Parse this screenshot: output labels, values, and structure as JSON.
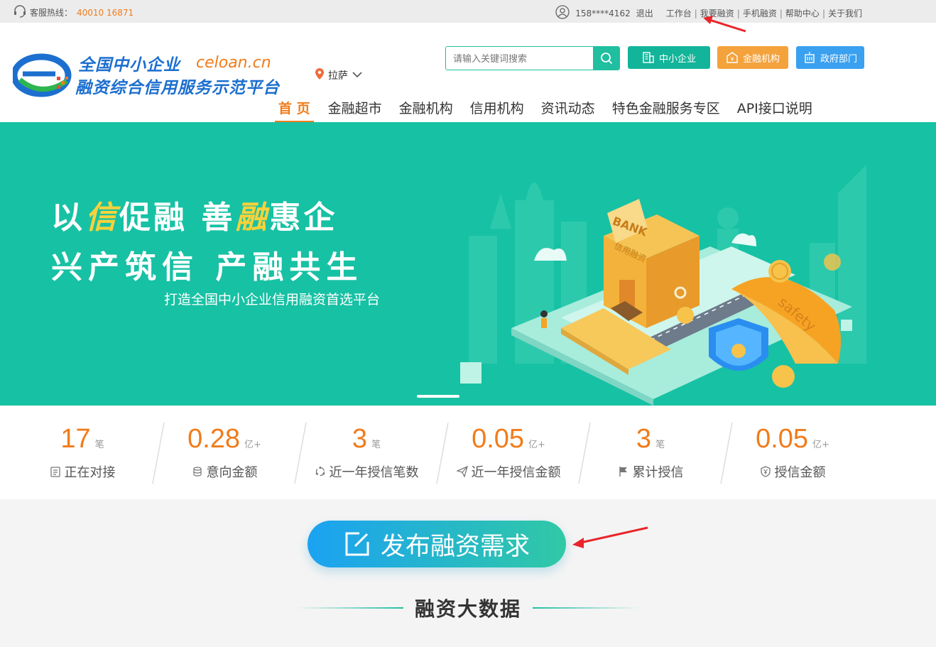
{
  "topbar": {
    "hotline_label": "客服热线：",
    "hotline_number": "40010 16871",
    "user_phone": "158****4162",
    "logout": "退出",
    "links": [
      "工作台",
      "我要融资",
      "手机融资",
      "帮助中心",
      "关于我们"
    ]
  },
  "header": {
    "logo_title1": "全国中小企业",
    "logo_url": "celoan.cn",
    "logo_title2": "融资综合信用服务示范平台",
    "location": "拉萨",
    "search_placeholder": "请输入关键词搜索",
    "quick_buttons": [
      {
        "label": "中小企业",
        "color": "#13b59a"
      },
      {
        "label": "金融机构",
        "color": "#f4a23c"
      },
      {
        "label": "政府部门",
        "color": "#3aa0f0"
      }
    ]
  },
  "nav": {
    "items": [
      "首 页",
      "金融超市",
      "金融机构",
      "信用机构",
      "资讯动态",
      "特色金融服务专区",
      "API接口说明"
    ],
    "active": "首 页"
  },
  "banner": {
    "slogan_line1_a": "以",
    "slogan_line1_b": "信",
    "slogan_line1_c": "促融  善",
    "slogan_line1_d": "融",
    "slogan_line1_e": "惠企",
    "slogan_line2": "兴产筑信  产融共生",
    "slogan_sub": "打造全国中小企业信用融资首选平台",
    "illustration_texts": {
      "bank": "BANK",
      "bank_sign": "信用融资",
      "umbrella": "safety"
    }
  },
  "stats": [
    {
      "value": "17",
      "unit": "笔",
      "label": "正在对接",
      "icon": "clipboard-icon"
    },
    {
      "value": "0.28",
      "unit": "亿+",
      "label": "意向金额",
      "icon": "coins-icon"
    },
    {
      "value": "3",
      "unit": "笔",
      "label": "近一年授信笔数",
      "icon": "cycle-icon"
    },
    {
      "value": "0.05",
      "unit": "亿+",
      "label": "近一年授信金额",
      "icon": "paper-plane-icon"
    },
    {
      "value": "3",
      "unit": "笔",
      "label": "累计授信",
      "icon": "flag-icon"
    },
    {
      "value": "0.05",
      "unit": "亿+",
      "label": "授信金额",
      "icon": "shield-yen-icon"
    }
  ],
  "publish_button": "发布融资需求",
  "section_title": "融资大数据",
  "colors": {
    "accent_orange": "#f07c1b",
    "primary_teal": "#1fbfa0",
    "banner_bg": "#17c1a4",
    "brand_blue": "#1c6fcf"
  }
}
